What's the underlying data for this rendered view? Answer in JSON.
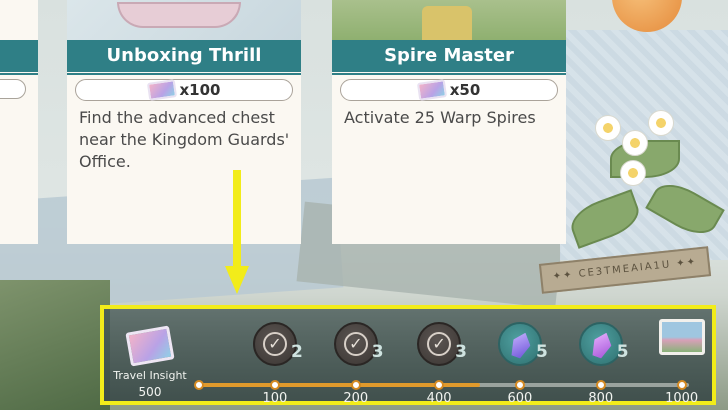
{
  "cards": [
    {
      "title": "Unboxing Thrill",
      "reward_icon": "travel-insight-ticket-icon",
      "reward_qty": "x100",
      "description": "Find the advanced chest near the Kingdom Guards' Office."
    },
    {
      "title": "Spire Master",
      "reward_icon": "travel-insight-ticket-icon",
      "reward_qty": "x50",
      "description": "Activate 25 Warp Spires"
    }
  ],
  "banner_text": "✦✦ CE3TMEAIA1U ✦✦",
  "progress": {
    "label": "Travel Insight",
    "current": "500",
    "current_value": 500,
    "milestones": [
      {
        "value": "100",
        "reward_qty": "2",
        "status": "claimed",
        "icon": "check-icon"
      },
      {
        "value": "200",
        "reward_qty": "3",
        "status": "claimed",
        "icon": "check-icon"
      },
      {
        "value": "400",
        "reward_qty": "3",
        "status": "claimed",
        "icon": "check-icon"
      },
      {
        "value": "600",
        "reward_qty": "5",
        "status": "open",
        "icon": "crystal-icon"
      },
      {
        "value": "800",
        "reward_qty": "5",
        "status": "open",
        "icon": "crystal-icon"
      },
      {
        "value": "1000",
        "reward_qty": "",
        "status": "open",
        "icon": "postcard-icon"
      }
    ]
  },
  "colors": {
    "accent_teal": "#2f7f86",
    "highlight_yellow": "#f2ec1a",
    "progress_orange": "#e09a2c"
  }
}
